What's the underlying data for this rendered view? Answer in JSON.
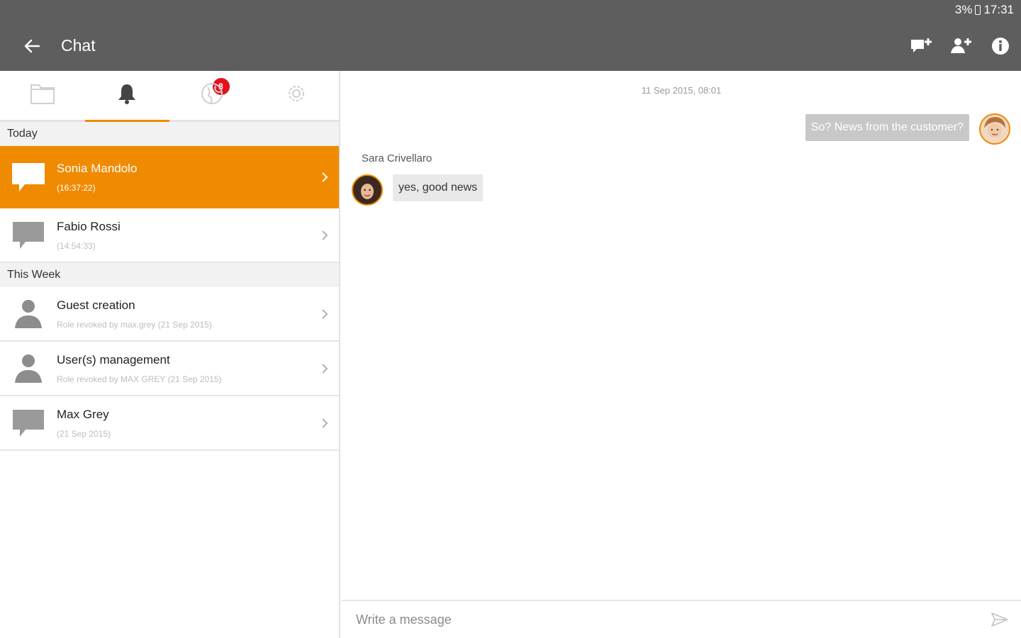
{
  "status": {
    "battery": "3%",
    "time": "17:31"
  },
  "header": {
    "title": "Chat"
  },
  "icons": {
    "back": "back-arrow-icon",
    "add_chat": "add-chat-icon",
    "add_user": "add-user-icon",
    "info": "info-icon"
  },
  "tabs": [
    {
      "icon": "folder-icon"
    },
    {
      "icon": "bell-icon",
      "badge": "8"
    },
    {
      "icon": "globe-icon"
    },
    {
      "icon": "gear-icon"
    }
  ],
  "sections": [
    {
      "label": "Today",
      "items": [
        {
          "title": "Sonia Mandolo",
          "subtitle": "(16:37:22)",
          "icon": "chat-bubble-icon",
          "active": true
        },
        {
          "title": "Fabio Rossi",
          "subtitle": "(14:54:33)",
          "icon": "chat-bubble-icon"
        }
      ]
    },
    {
      "label": "This Week",
      "items": [
        {
          "title": "Guest creation",
          "subtitle": "Role revoked by max.grey (21 Sep 2015)",
          "icon": "person-icon"
        },
        {
          "title": "User(s) management",
          "subtitle": "Role revoked by MAX GREY (21 Sep 2015)",
          "icon": "person-icon"
        },
        {
          "title": "Max Grey",
          "subtitle": "(21 Sep 2015)",
          "icon": "chat-bubble-icon"
        }
      ]
    }
  ],
  "conversation": {
    "date": "11 Sep 2015, 08:01",
    "outgoing": "So? News from the customer?",
    "sender": "Sara Crivellaro",
    "incoming": "yes, good news"
  },
  "composer": {
    "placeholder": "Write a message"
  },
  "colors": {
    "accent": "#f08a00",
    "appbar": "#5e5e5e",
    "badge": "#e2111b"
  }
}
